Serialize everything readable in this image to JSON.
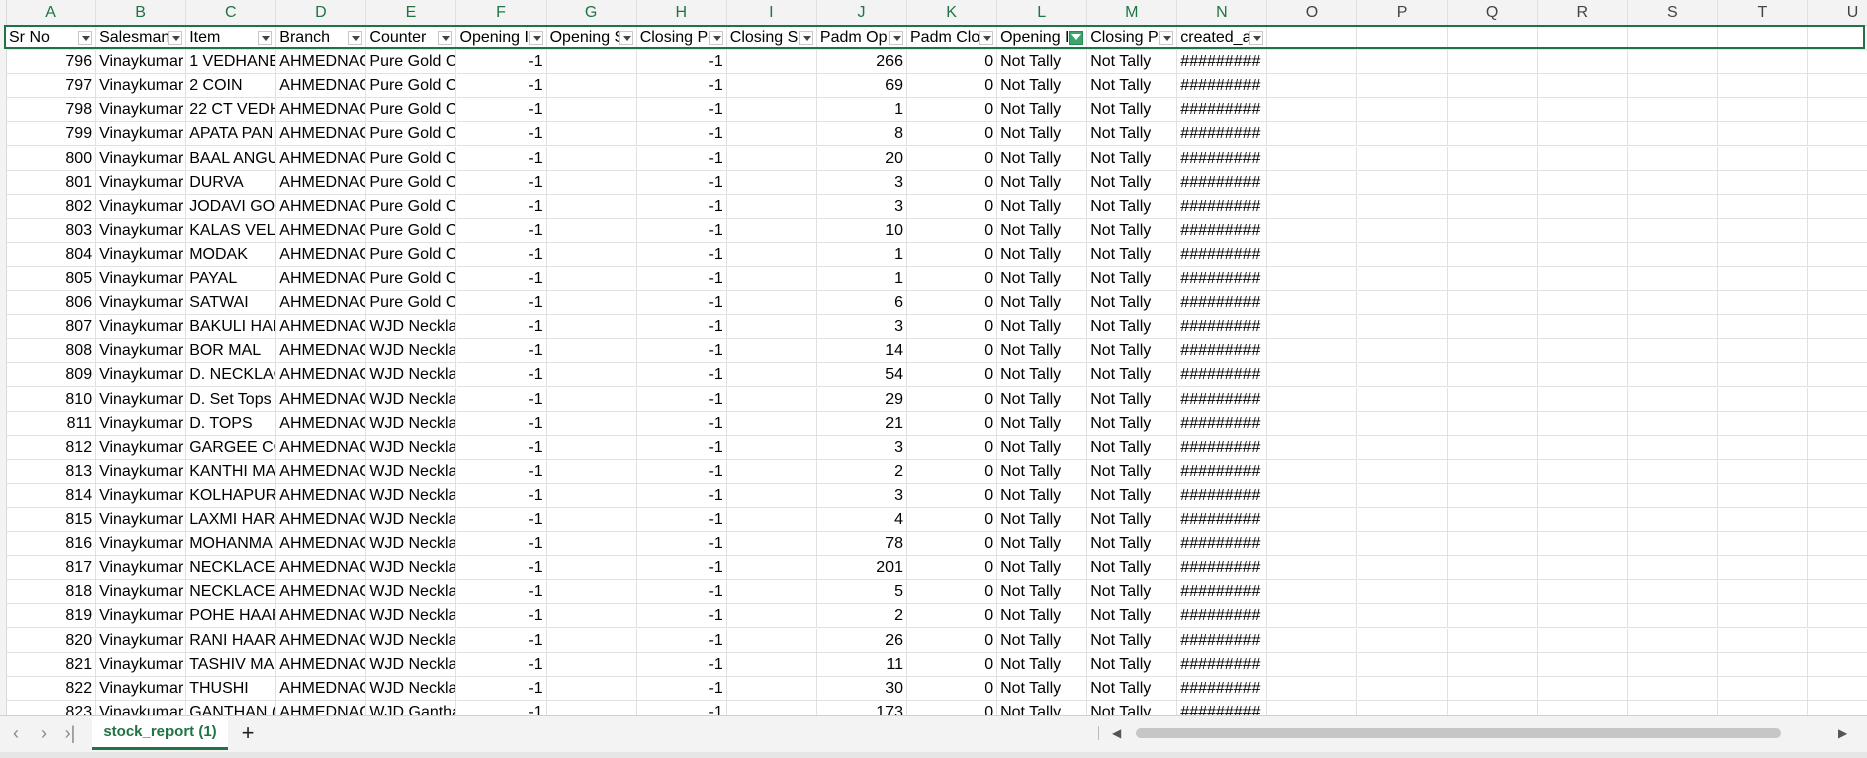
{
  "columns": [
    "A",
    "B",
    "C",
    "D",
    "E",
    "F",
    "G",
    "H",
    "I",
    "J",
    "K",
    "L",
    "M",
    "N",
    "O",
    "P",
    "Q",
    "R",
    "S",
    "T",
    "U"
  ],
  "headers": [
    "Sr No",
    "Salesman",
    "Item",
    "Branch",
    "Counter",
    "Opening I",
    "Opening S",
    "Closing Pc",
    "Closing Sa",
    "Padm Op",
    "Padm Clo",
    "Opening I",
    "Closing Pc",
    "created_a"
  ],
  "active_filter_column": 11,
  "rows": [
    [
      "796",
      "Vinaykumar",
      "1 VEDHANE",
      "AHMEDNAG",
      "Pure Gold C",
      "-1",
      "",
      "-1",
      "",
      "266",
      "0",
      "Not Tally",
      "Not Tally",
      "#########"
    ],
    [
      "797",
      "Vinaykumar",
      "2 COIN",
      "AHMEDNAG",
      "Pure Gold C",
      "-1",
      "",
      "-1",
      "",
      "69",
      "0",
      "Not Tally",
      "Not Tally",
      "#########"
    ],
    [
      "798",
      "Vinaykumar",
      "22 CT VEDH",
      "AHMEDNAG",
      "Pure Gold C",
      "-1",
      "",
      "-1",
      "",
      "1",
      "0",
      "Not Tally",
      "Not Tally",
      "#########"
    ],
    [
      "799",
      "Vinaykumar",
      "APATA PAN",
      "AHMEDNAG",
      "Pure Gold C",
      "-1",
      "",
      "-1",
      "",
      "8",
      "0",
      "Not Tally",
      "Not Tally",
      "#########"
    ],
    [
      "800",
      "Vinaykumar",
      "BAAL ANGU",
      "AHMEDNAG",
      "Pure Gold C",
      "-1",
      "",
      "-1",
      "",
      "20",
      "0",
      "Not Tally",
      "Not Tally",
      "#########"
    ],
    [
      "801",
      "Vinaykumar",
      "DURVA",
      "AHMEDNAG",
      "Pure Gold C",
      "-1",
      "",
      "-1",
      "",
      "3",
      "0",
      "Not Tally",
      "Not Tally",
      "#########"
    ],
    [
      "802",
      "Vinaykumar",
      "JODAVI GOL",
      "AHMEDNAG",
      "Pure Gold C",
      "-1",
      "",
      "-1",
      "",
      "3",
      "0",
      "Not Tally",
      "Not Tally",
      "#########"
    ],
    [
      "803",
      "Vinaykumar",
      "KALAS VEL",
      "AHMEDNAG",
      "Pure Gold C",
      "-1",
      "",
      "-1",
      "",
      "10",
      "0",
      "Not Tally",
      "Not Tally",
      "#########"
    ],
    [
      "804",
      "Vinaykumar",
      "MODAK",
      "AHMEDNAG",
      "Pure Gold C",
      "-1",
      "",
      "-1",
      "",
      "1",
      "0",
      "Not Tally",
      "Not Tally",
      "#########"
    ],
    [
      "805",
      "Vinaykumar",
      "PAYAL",
      "AHMEDNAG",
      "Pure Gold C",
      "-1",
      "",
      "-1",
      "",
      "1",
      "0",
      "Not Tally",
      "Not Tally",
      "#########"
    ],
    [
      "806",
      "Vinaykumar",
      "SATWAI",
      "AHMEDNAG",
      "Pure Gold C",
      "-1",
      "",
      "-1",
      "",
      "6",
      "0",
      "Not Tally",
      "Not Tally",
      "#########"
    ],
    [
      "807",
      "Vinaykumar",
      "BAKULI HAF",
      "AHMEDNAG",
      "WJD Neckla",
      "-1",
      "",
      "-1",
      "",
      "3",
      "0",
      "Not Tally",
      "Not Tally",
      "#########"
    ],
    [
      "808",
      "Vinaykumar",
      "BOR MAL",
      "AHMEDNAG",
      "WJD Neckla",
      "-1",
      "",
      "-1",
      "",
      "14",
      "0",
      "Not Tally",
      "Not Tally",
      "#########"
    ],
    [
      "809",
      "Vinaykumar",
      "D. NECKLAC",
      "AHMEDNAG",
      "WJD Neckla",
      "-1",
      "",
      "-1",
      "",
      "54",
      "0",
      "Not Tally",
      "Not Tally",
      "#########"
    ],
    [
      "810",
      "Vinaykumar",
      "D. Set Tops",
      "AHMEDNAG",
      "WJD Neckla",
      "-1",
      "",
      "-1",
      "",
      "29",
      "0",
      "Not Tally",
      "Not Tally",
      "#########"
    ],
    [
      "811",
      "Vinaykumar",
      "D. TOPS",
      "AHMEDNAG",
      "WJD Neckla",
      "-1",
      "",
      "-1",
      "",
      "21",
      "0",
      "Not Tally",
      "Not Tally",
      "#########"
    ],
    [
      "812",
      "Vinaykumar",
      "GARGEE CO",
      "AHMEDNAG",
      "WJD Neckla",
      "-1",
      "",
      "-1",
      "",
      "3",
      "0",
      "Not Tally",
      "Not Tally",
      "#########"
    ],
    [
      "813",
      "Vinaykumar",
      "KANTHI MA",
      "AHMEDNAG",
      "WJD Neckla",
      "-1",
      "",
      "-1",
      "",
      "2",
      "0",
      "Not Tally",
      "Not Tally",
      "#########"
    ],
    [
      "814",
      "Vinaykumar",
      "KOLHAPURI",
      "AHMEDNAG",
      "WJD Neckla",
      "-1",
      "",
      "-1",
      "",
      "3",
      "0",
      "Not Tally",
      "Not Tally",
      "#########"
    ],
    [
      "815",
      "Vinaykumar",
      "LAXMI HAR",
      "AHMEDNAG",
      "WJD Neckla",
      "-1",
      "",
      "-1",
      "",
      "4",
      "0",
      "Not Tally",
      "Not Tally",
      "#########"
    ],
    [
      "816",
      "Vinaykumar",
      "MOHANMA",
      "AHMEDNAG",
      "WJD Neckla",
      "-1",
      "",
      "-1",
      "",
      "78",
      "0",
      "Not Tally",
      "Not Tally",
      "#########"
    ],
    [
      "817",
      "Vinaykumar",
      "NECKLACE (",
      "AHMEDNAG",
      "WJD Neckla",
      "-1",
      "",
      "-1",
      "",
      "201",
      "0",
      "Not Tally",
      "Not Tally",
      "#########"
    ],
    [
      "818",
      "Vinaykumar",
      "NECKLACE S",
      "AHMEDNAG",
      "WJD Neckla",
      "-1",
      "",
      "-1",
      "",
      "5",
      "0",
      "Not Tally",
      "Not Tally",
      "#########"
    ],
    [
      "819",
      "Vinaykumar",
      "POHE HAAR",
      "AHMEDNAG",
      "WJD Neckla",
      "-1",
      "",
      "-1",
      "",
      "2",
      "0",
      "Not Tally",
      "Not Tally",
      "#########"
    ],
    [
      "820",
      "Vinaykumar",
      "RANI HAAR",
      "AHMEDNAG",
      "WJD Neckla",
      "-1",
      "",
      "-1",
      "",
      "26",
      "0",
      "Not Tally",
      "Not Tally",
      "#########"
    ],
    [
      "821",
      "Vinaykumar",
      "TASHIV MAI",
      "AHMEDNAG",
      "WJD Neckla",
      "-1",
      "",
      "-1",
      "",
      "11",
      "0",
      "Not Tally",
      "Not Tally",
      "#########"
    ],
    [
      "822",
      "Vinaykumar",
      "THUSHI",
      "AHMEDNAG",
      "WJD Neckla",
      "-1",
      "",
      "-1",
      "",
      "30",
      "0",
      "Not Tally",
      "Not Tally",
      "#########"
    ],
    [
      "823",
      "Vinaykumar",
      "GANTHAN (I",
      "AHMEDNAG",
      "WJD Gantha",
      "-1",
      "",
      "-1",
      "",
      "173",
      "0",
      "Not Tally",
      "Not Tally",
      "#########"
    ]
  ],
  "tabs": {
    "sheet_name": "stock_report (1)",
    "add_label": "+"
  },
  "icons": {
    "filter": "filter-dropdown-icon",
    "active_filter": "active-filter-icon",
    "nav_prev": "chevron-left-icon",
    "nav_next": "chevron-right-icon",
    "nav_last": "chevron-last-icon",
    "add": "plus-icon"
  },
  "colors": {
    "accent": "#217346",
    "active_filter": "#3aa66b"
  }
}
